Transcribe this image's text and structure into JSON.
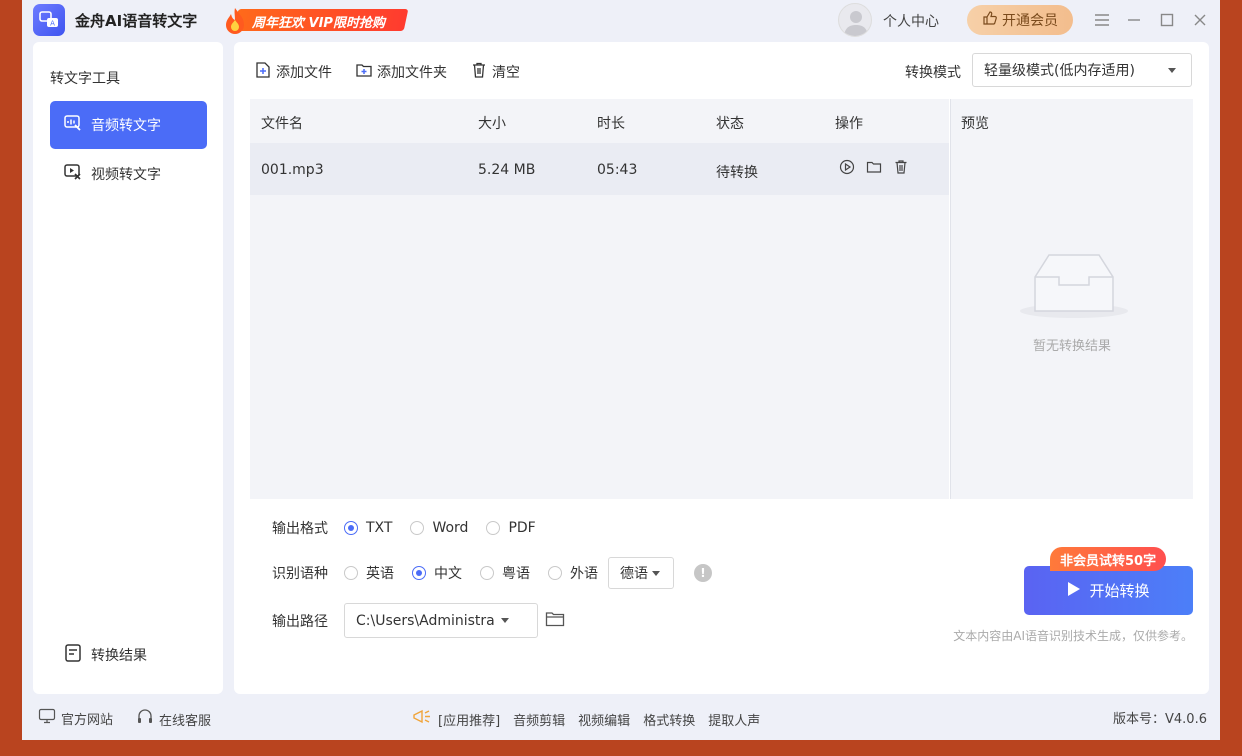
{
  "app": {
    "title": "金舟AI语音转文字",
    "promo": "周年狂欢 VIP限时抢购",
    "user_center": "个人中心",
    "vip_button": "开通会员",
    "accent": "#4b6cf7"
  },
  "sidebar": {
    "title": "转文字工具",
    "items": [
      {
        "label": "音频转文字",
        "icon": "audio-text-icon",
        "active": true
      },
      {
        "label": "视频转文字",
        "icon": "video-text-icon",
        "active": false
      }
    ],
    "results": "转换结果"
  },
  "toolbar": {
    "add_file": "添加文件",
    "add_folder": "添加文件夹",
    "clear": "清空",
    "mode_label": "转换模式",
    "mode_value": "轻量级模式(低内存适用)"
  },
  "table": {
    "headers": [
      "文件名",
      "大小",
      "时长",
      "状态",
      "操作"
    ],
    "rows": [
      {
        "name": "001.mp3",
        "size": "5.24 MB",
        "duration": "05:43",
        "status": "待转换"
      }
    ]
  },
  "preview": {
    "title": "预览",
    "empty": "暂无转换结果"
  },
  "options": {
    "format_label": "输出格式",
    "formats": [
      "TXT",
      "Word",
      "PDF"
    ],
    "format_selected": "TXT",
    "lang_label": "识别语种",
    "langs": [
      "英语",
      "中文",
      "粤语",
      "外语"
    ],
    "lang_selected": "中文",
    "foreign_value": "德语",
    "path_label": "输出路径",
    "path_value": "C:\\Users\\Administra"
  },
  "start": {
    "button": "开始转换",
    "trial_tag": "非会员试转50字",
    "disclaimer": "文本内容由AI语音识别技术生成，仅供参考。"
  },
  "footer": {
    "website": "官方网站",
    "support": "在线客服",
    "recommend": "[应用推荐]",
    "apps": [
      "音频剪辑",
      "视频编辑",
      "格式转换",
      "提取人声"
    ],
    "version": "版本号：V4.0.6"
  }
}
